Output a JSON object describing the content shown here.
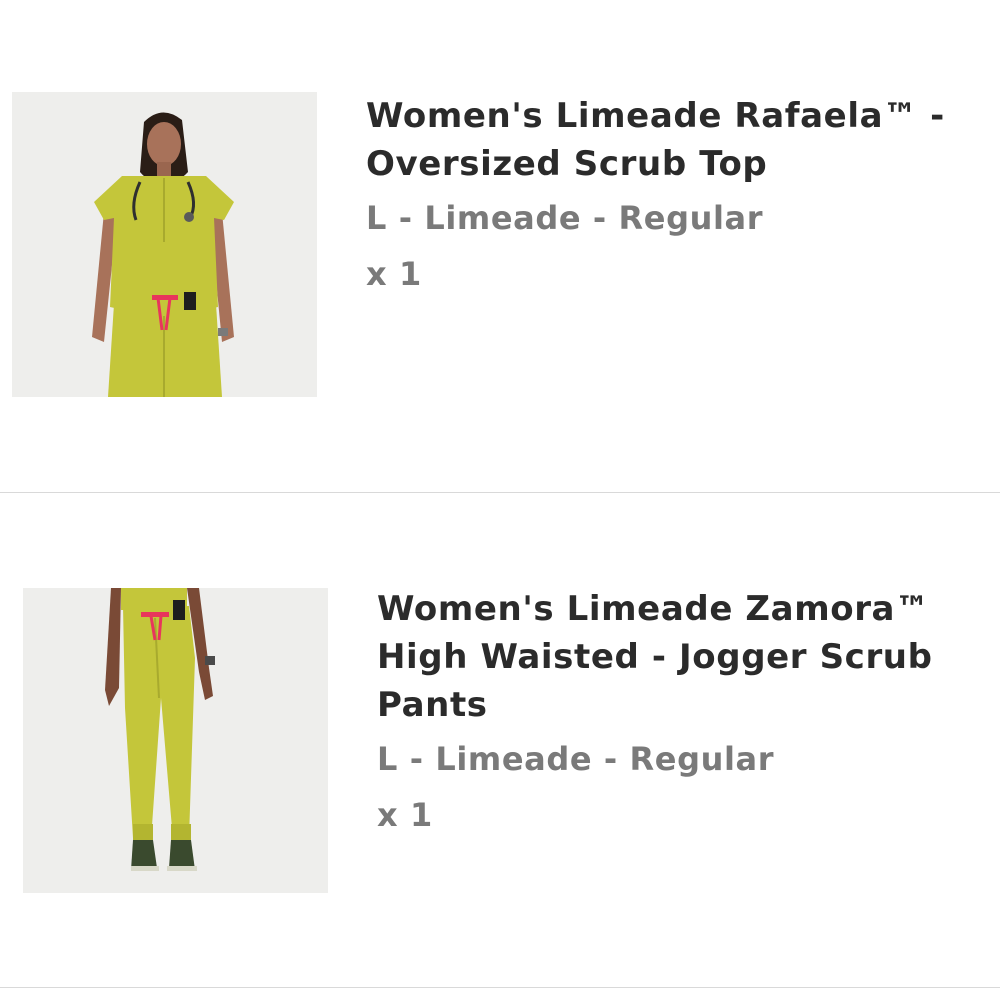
{
  "cart": {
    "items": [
      {
        "title": "Women's Limeade Rafaela™ - Oversized Scrub Top",
        "variant": "L - Limeade - Regular",
        "quantity": "x 1",
        "image_subject": "model wearing limeade oversized scrub top with stethoscope"
      },
      {
        "title": "Women's Limeade Zamora™ High Waisted - Jogger Scrub Pants",
        "variant": "L - Limeade - Regular",
        "quantity": "x 1",
        "image_subject": "model wearing limeade high waisted jogger scrub pants"
      }
    ]
  },
  "colors": {
    "garment": "#c4c63a",
    "accent_drawstring": "#e8365c",
    "image_background": "#eeeeec",
    "title_text": "#2b2b2b",
    "meta_text": "#7a7a7a",
    "divider": "#d9d9d9"
  }
}
